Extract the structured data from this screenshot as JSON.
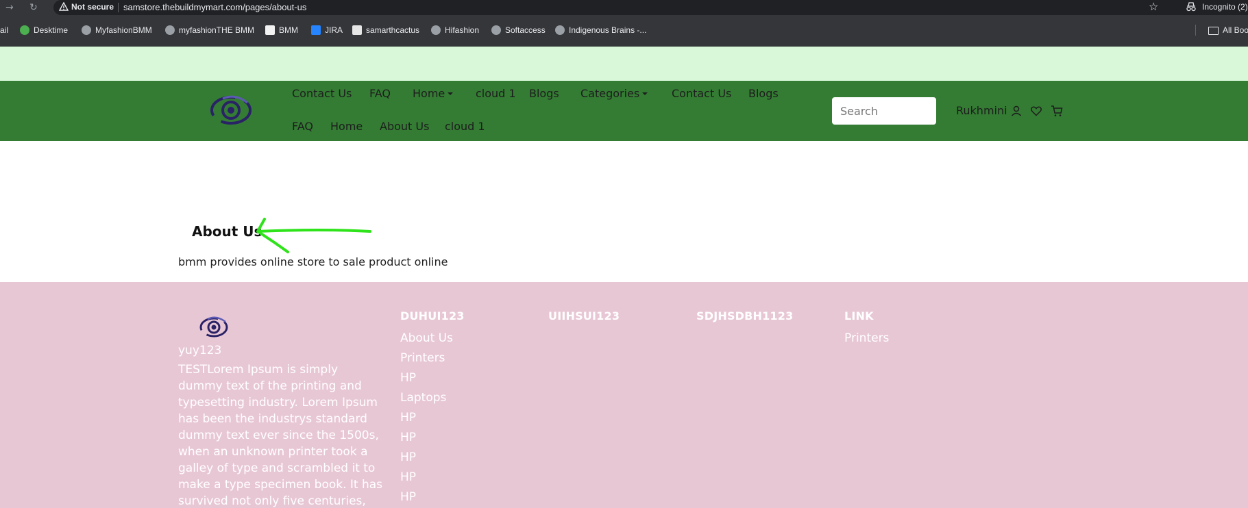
{
  "browser": {
    "security_label": "Not secure",
    "url": "samstore.thebuildmymart.com/pages/about-us",
    "incognito_label": "Incognito (2)",
    "bookmarks": [
      "ail",
      "Desktime",
      "MyfashionBMM",
      "myfashionTHE BMM",
      "BMM",
      "JIRA",
      "samarthcactus",
      "Hifashion",
      "Softaccess",
      "Indigenous Brains -..."
    ],
    "all_bookmarks_label": "All Boo"
  },
  "header": {
    "nav_row1": [
      {
        "label": "Contact Us",
        "dropdown": false
      },
      {
        "label": "FAQ",
        "dropdown": false
      },
      {
        "label": "Home",
        "dropdown": true
      },
      {
        "label": "cloud 1",
        "dropdown": false
      },
      {
        "label": "Blogs",
        "dropdown": false
      },
      {
        "label": "Categories",
        "dropdown": true
      },
      {
        "label": "Contact Us",
        "dropdown": false
      },
      {
        "label": "Blogs",
        "dropdown": false
      }
    ],
    "nav_row2": [
      "FAQ",
      "Home",
      "About Us",
      "cloud 1"
    ],
    "search_placeholder": "Search",
    "user_name": "Rukhmini"
  },
  "colors": {
    "announce_bg": "#d9f7d9",
    "header_bg": "#347c33",
    "footer_bg": "#e8c7d5",
    "arrow": "#2ee31a"
  },
  "content": {
    "title": "About Us",
    "text": "bmm provides online store to sale product online"
  },
  "footer": {
    "brand": "yuy123",
    "description": "TESTLorem Ipsum is simply dummy text of the printing and typesetting industry. Lorem Ipsum has been the industrys standard dummy text ever since the 1500s, when an unknown printer took a galley of type and scrambled it to make a type specimen book. It has survived not only five centuries, but also the leap",
    "columns": [
      {
        "heading": "DUHUI123",
        "links": [
          "About Us",
          "Printers",
          "HP",
          "Laptops",
          "HP",
          "HP",
          "HP",
          "HP",
          "HP"
        ]
      },
      {
        "heading": "UIIHSUI123",
        "links": []
      },
      {
        "heading": "SDJHSDBH1123",
        "links": []
      },
      {
        "heading": "LINK",
        "links": [
          "Printers"
        ]
      }
    ]
  }
}
